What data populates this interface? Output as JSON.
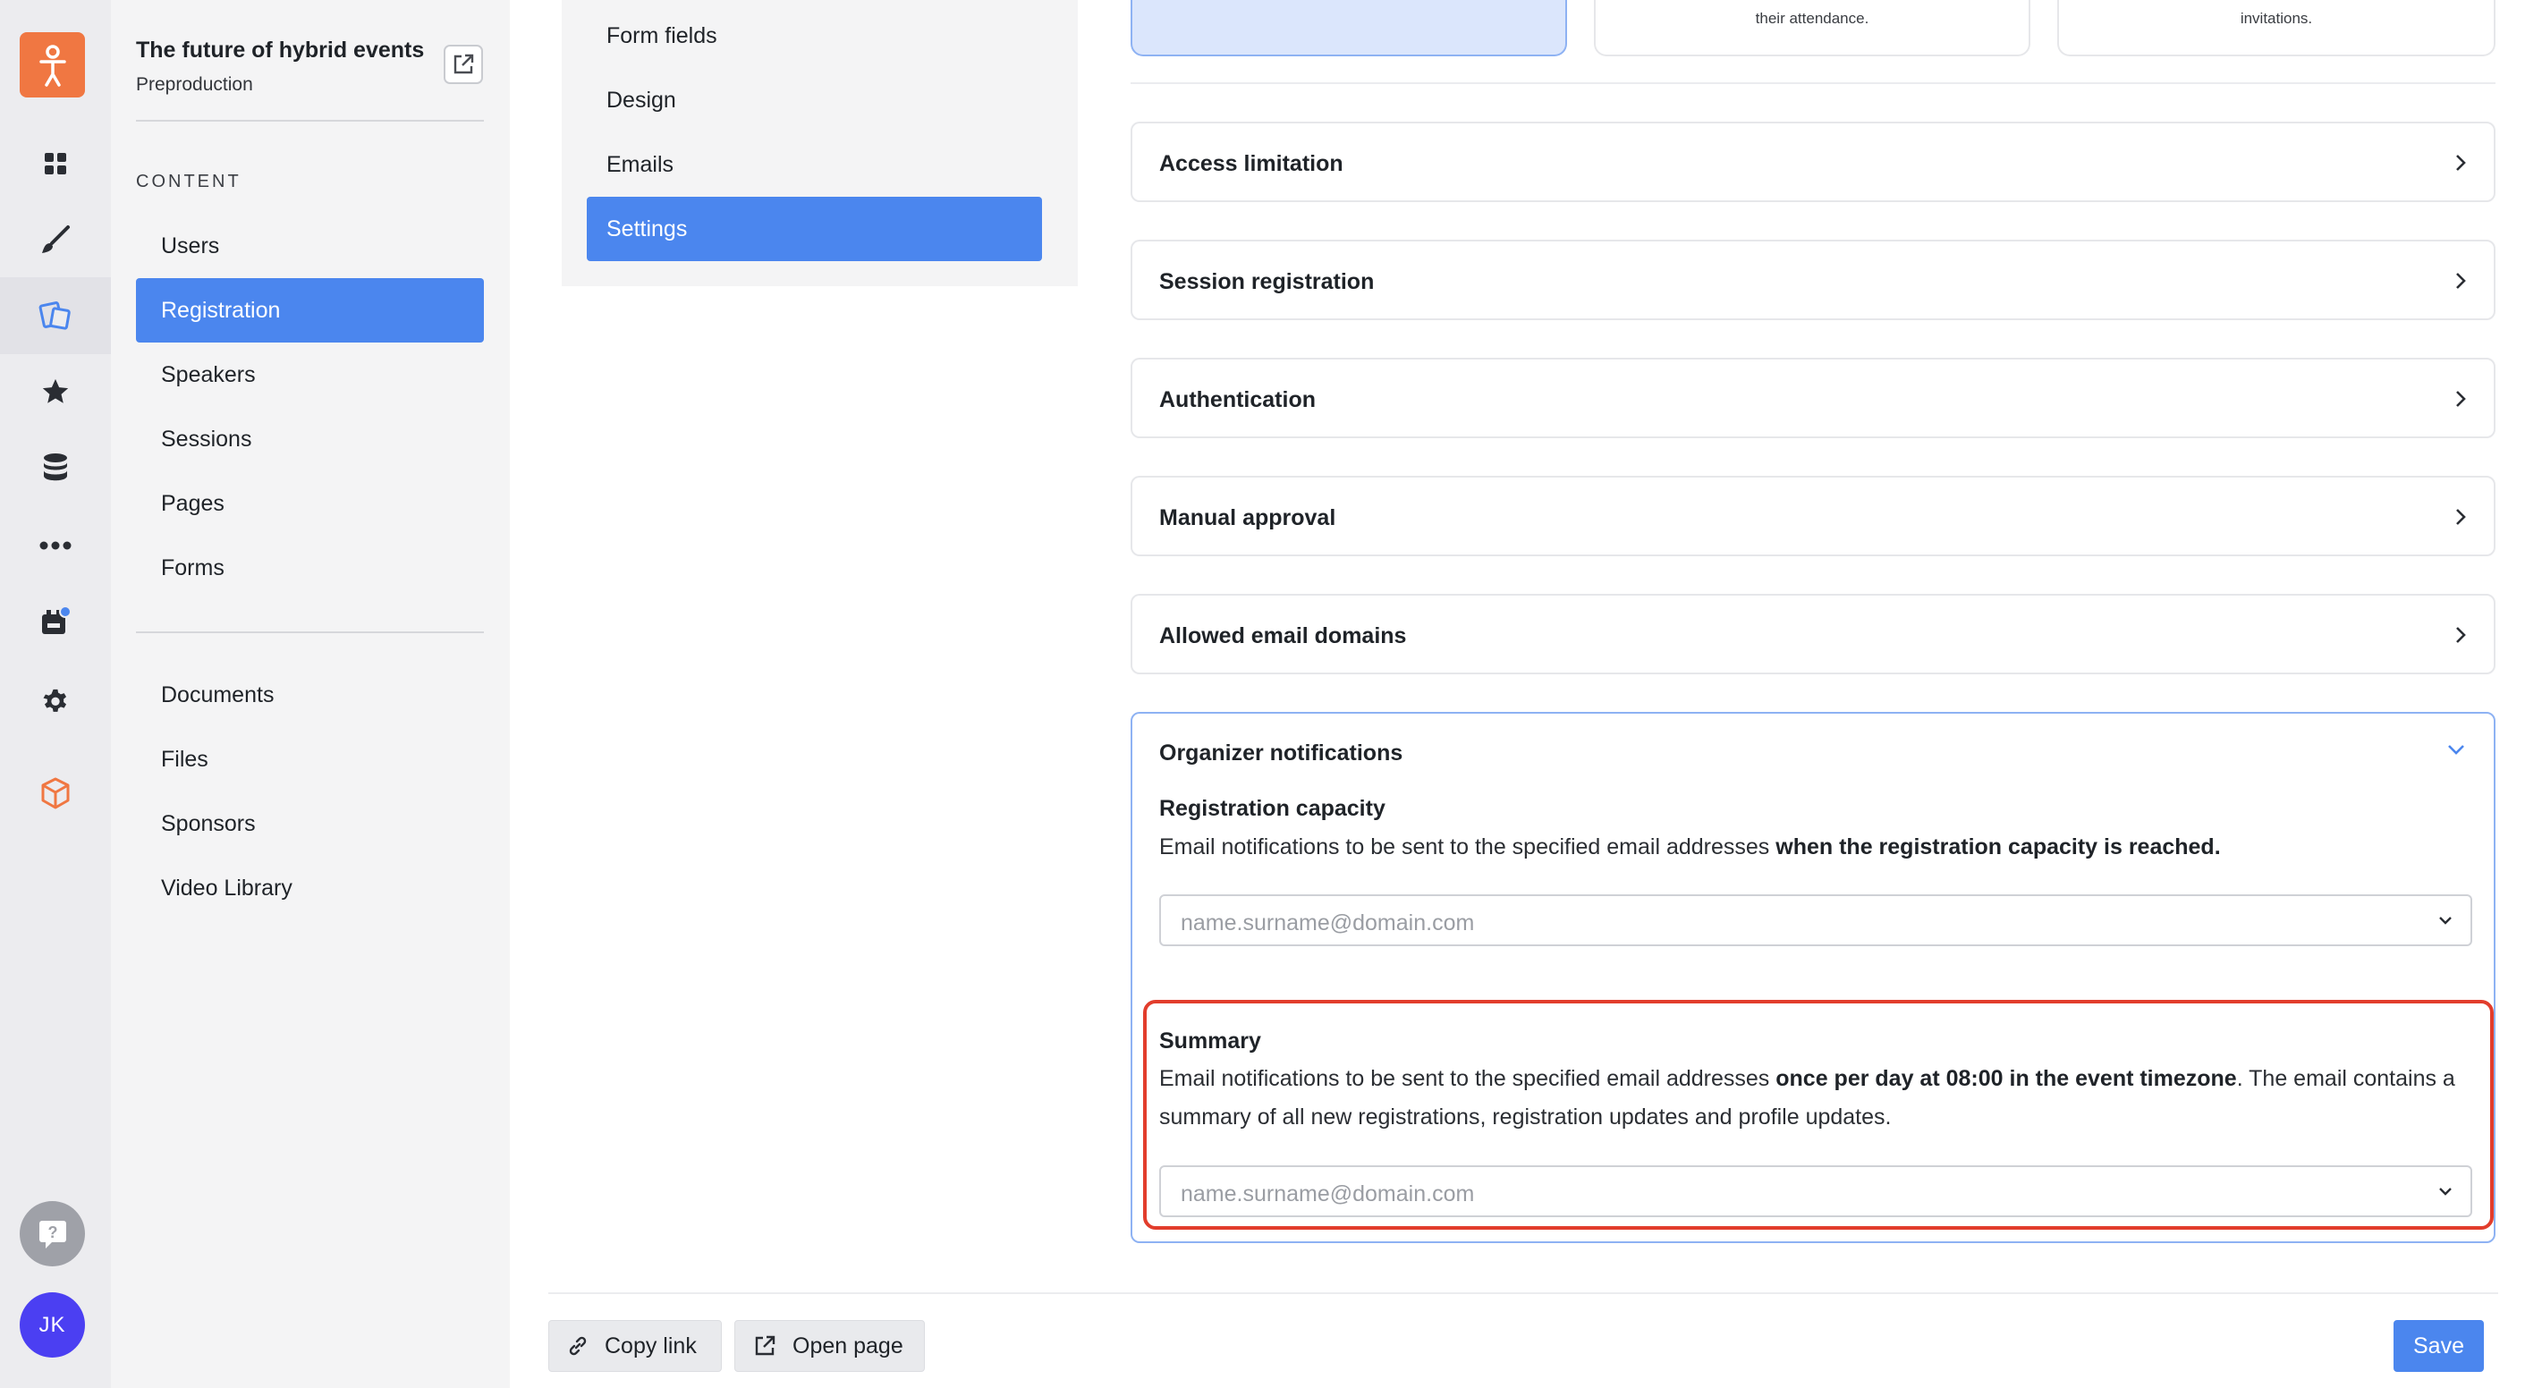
{
  "rail": {
    "items": [
      {
        "icon": "dashboard-icon"
      },
      {
        "icon": "brush-icon"
      },
      {
        "icon": "registration-icon",
        "active": true
      },
      {
        "icon": "star-icon"
      },
      {
        "icon": "database-icon"
      },
      {
        "icon": "more-icon"
      },
      {
        "icon": "marketplace-icon"
      },
      {
        "icon": "gear-icon"
      },
      {
        "icon": "cube-icon"
      }
    ],
    "avatar_initials": "JK",
    "brand_color": "#f07742",
    "accent": "#4b86ee"
  },
  "event": {
    "title": "The future of hybrid events",
    "status": "Preproduction"
  },
  "sidebar": {
    "section_label": "CONTENT",
    "items": [
      "Users",
      "Registration",
      "Speakers",
      "Sessions",
      "Pages",
      "Forms"
    ],
    "active": "Registration",
    "secondary_items": [
      "Documents",
      "Files",
      "Sponsors",
      "Video Library"
    ]
  },
  "subnav": {
    "items": [
      "Form fields",
      "Design",
      "Emails",
      "Settings"
    ],
    "active": "Settings"
  },
  "top_cards": [
    "",
    "their attendance.",
    "invitations."
  ],
  "accordions": [
    "Access limitation",
    "Session registration",
    "Authentication",
    "Manual approval",
    "Allowed email domains"
  ],
  "organizer_notifications": {
    "title": "Organizer notifications",
    "capacity": {
      "title": "Registration capacity",
      "desc_prefix": "Email notifications to be sent to the specified email addresses ",
      "desc_bold": "when the registration capacity is reached.",
      "placeholder": "name.surname@domain.com"
    },
    "summary": {
      "title": "Summary",
      "desc_prefix": "Email notifications to be sent to the specified email addresses ",
      "desc_bold": "once per day at 08:00 in the event timezone",
      "desc_suffix": ". The email contains a summary of all new registrations, registration updates and profile updates.",
      "placeholder": "name.surname@domain.com"
    }
  },
  "footer": {
    "copy_link": "Copy link",
    "open_page": "Open page",
    "save": "Save"
  }
}
